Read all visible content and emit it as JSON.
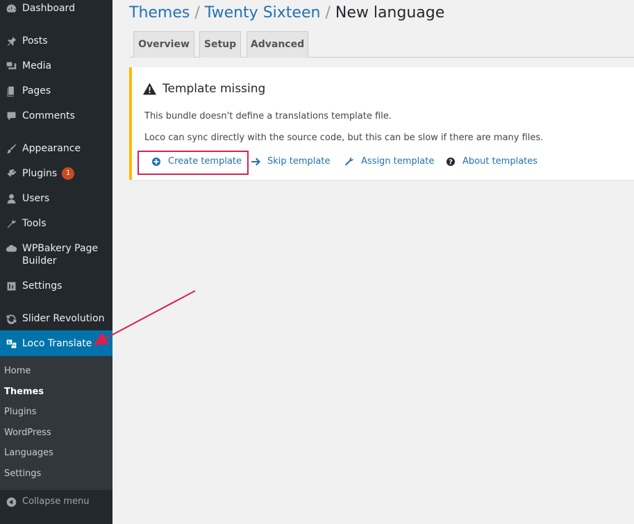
{
  "sidebar": {
    "items": [
      {
        "label": "Dashboard",
        "icon": "dashboard-icon"
      },
      {
        "label": "Posts",
        "icon": "pin-icon"
      },
      {
        "label": "Media",
        "icon": "media-icon"
      },
      {
        "label": "Pages",
        "icon": "pages-icon"
      },
      {
        "label": "Comments",
        "icon": "comment-icon"
      },
      {
        "label": "Appearance",
        "icon": "brush-icon"
      },
      {
        "label": "Plugins",
        "icon": "plugin-icon",
        "badge": "1"
      },
      {
        "label": "Users",
        "icon": "user-icon"
      },
      {
        "label": "Tools",
        "icon": "wrench-icon"
      },
      {
        "label": "WPBakery Page Builder",
        "icon": "cloud-icon"
      },
      {
        "label": "Settings",
        "icon": "settings-icon"
      },
      {
        "label": "Slider Revolution",
        "icon": "refresh-icon"
      },
      {
        "label": "Loco Translate",
        "icon": "translate-icon"
      }
    ],
    "submenu": [
      "Home",
      "Themes",
      "Plugins",
      "WordPress",
      "Languages",
      "Settings"
    ],
    "collapse_label": "Collapse menu"
  },
  "breadcrumb": {
    "first": "Themes",
    "second": "Twenty Sixteen",
    "current": "New language",
    "separator": "/"
  },
  "tabs": [
    "Overview",
    "Setup",
    "Advanced"
  ],
  "notice": {
    "title": "Template missing",
    "line1": "This bundle doesn't define a translations template file.",
    "line2": "Loco can sync directly with the source code, but this can be slow if there are many files.",
    "actions": [
      {
        "label": "Create template",
        "icon": "plus-circle-icon"
      },
      {
        "label": "Skip template",
        "icon": "arrow-right-icon"
      },
      {
        "label": "Assign template",
        "icon": "wrench-icon"
      },
      {
        "label": "About templates",
        "icon": "help-icon"
      }
    ]
  },
  "colors": {
    "sidebar_bg": "#23282d",
    "active_bg": "#0073aa",
    "link": "#2271b1",
    "warning": "#ffb900",
    "annotation": "#d6214e"
  }
}
